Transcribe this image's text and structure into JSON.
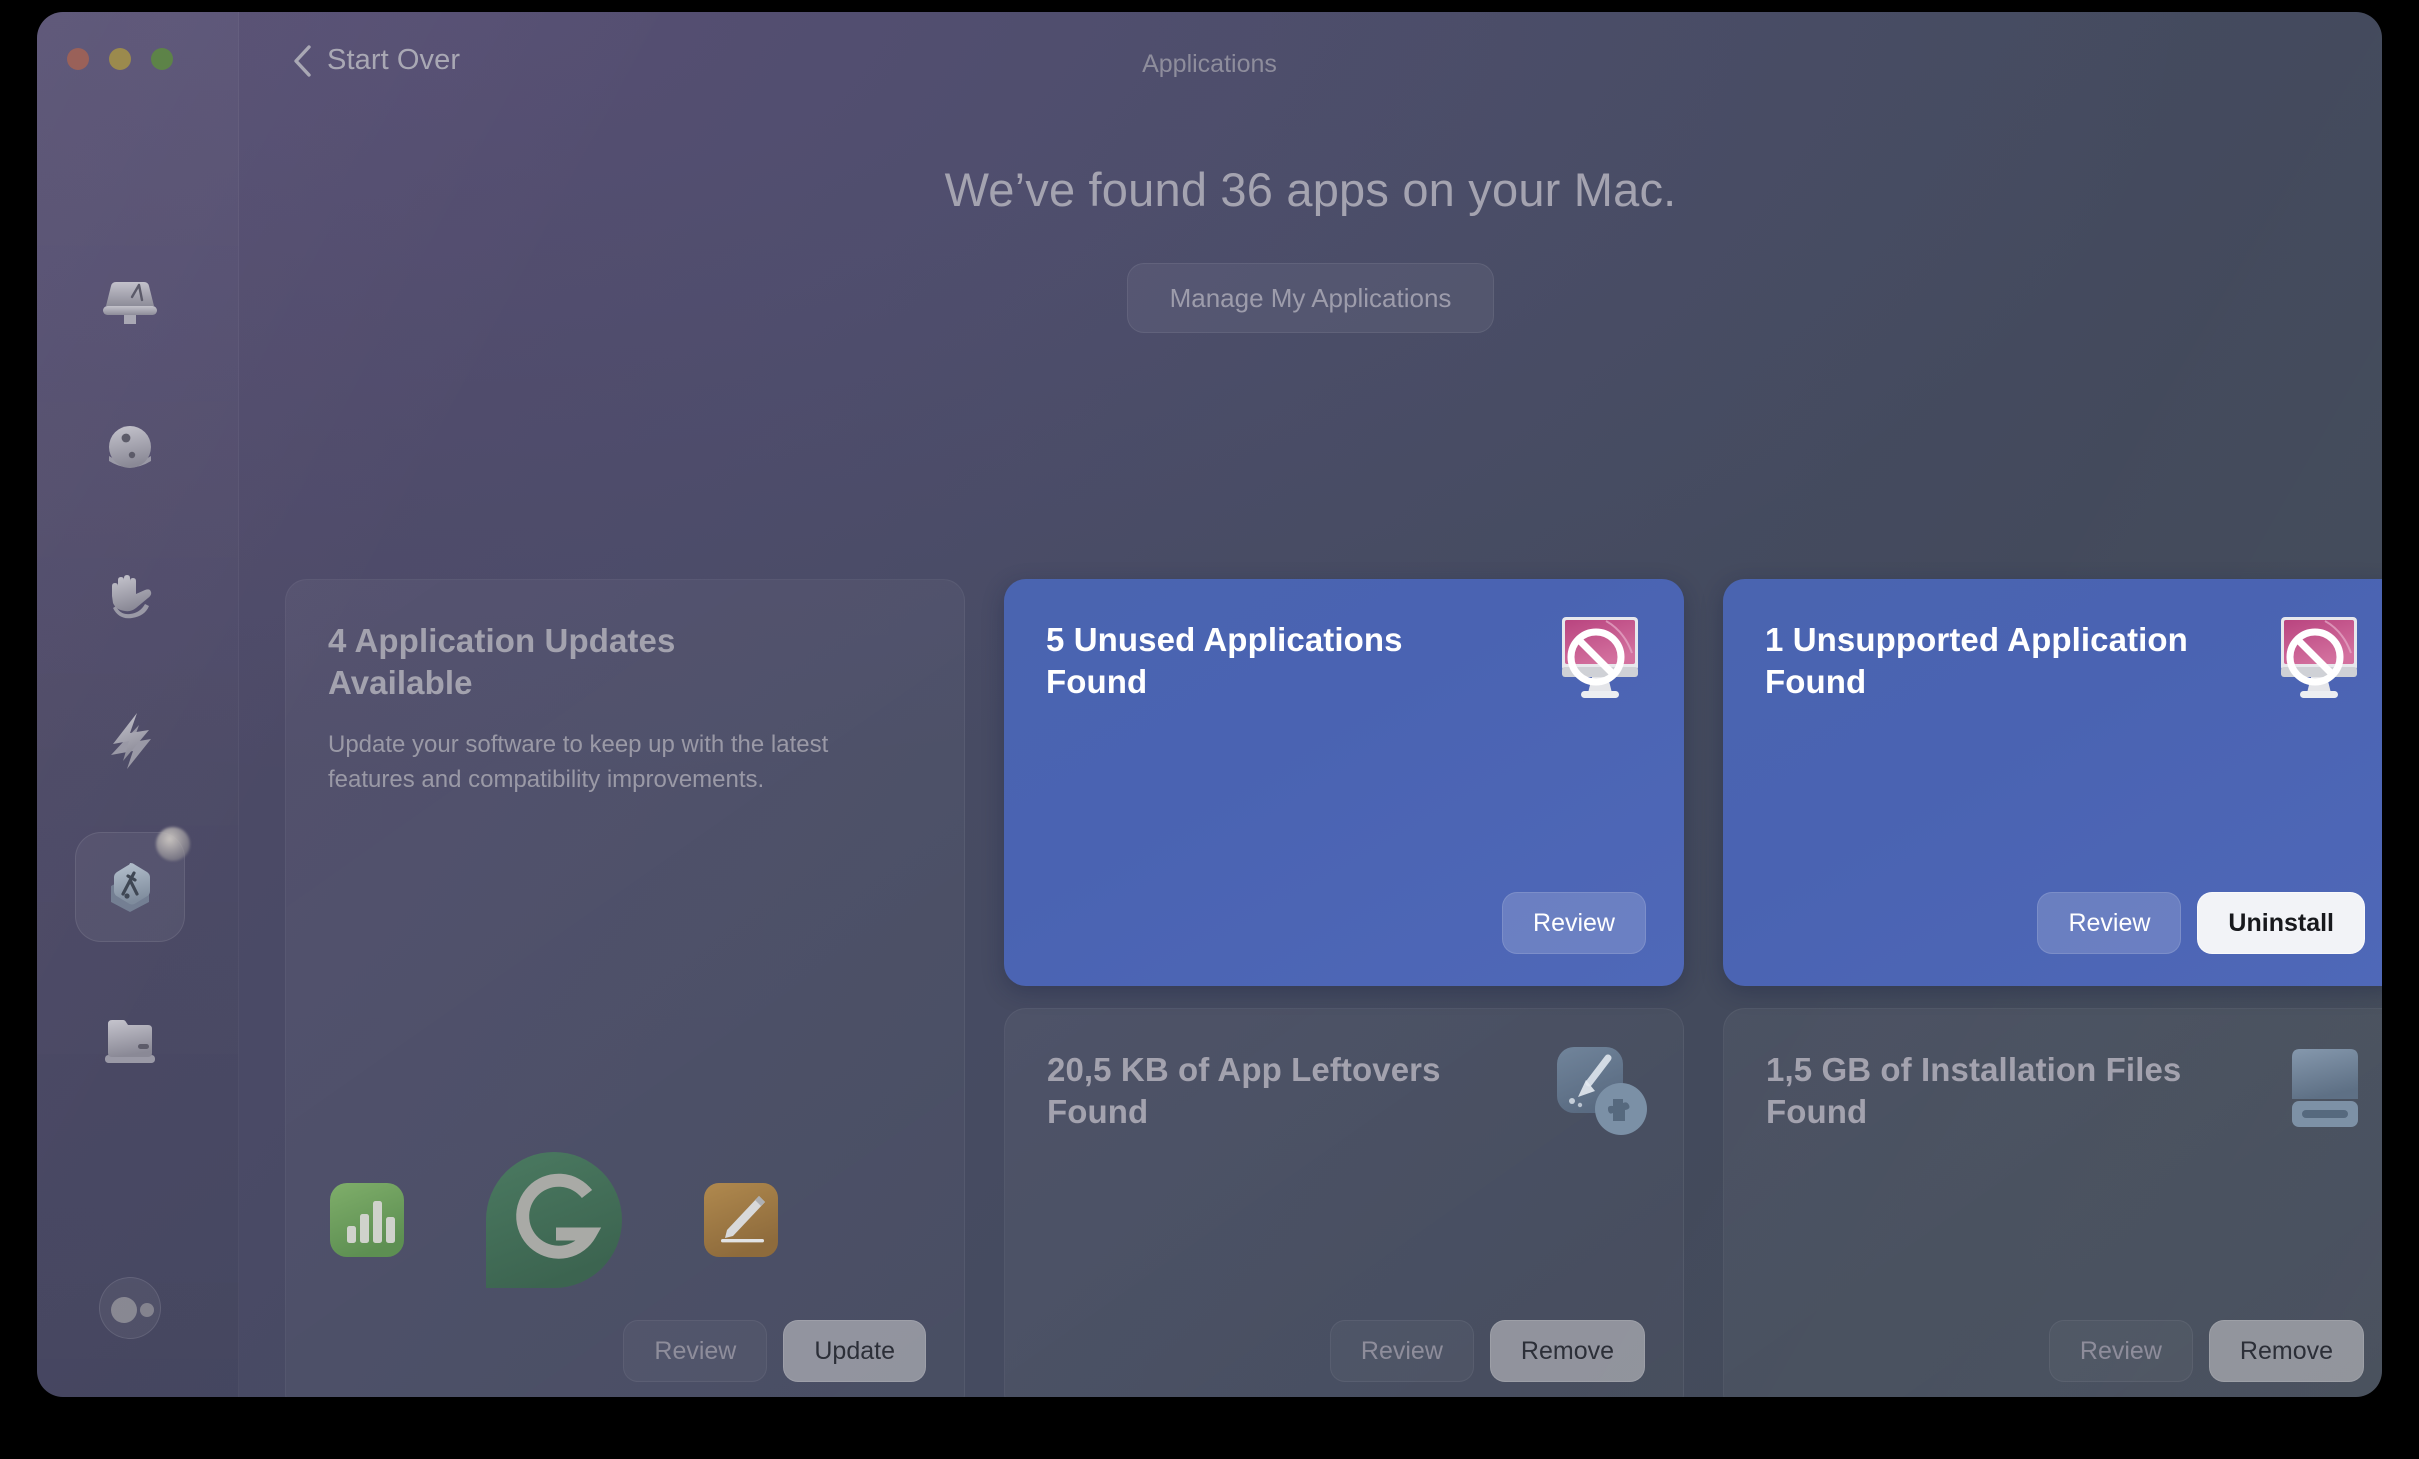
{
  "window": {
    "title": "Applications",
    "back_label": "Start Over",
    "traffic_lights": [
      "close-button",
      "minimize-button",
      "zoom-button"
    ]
  },
  "sidebar": {
    "items": [
      {
        "id": "smart-scan",
        "icon": "scanner-icon",
        "selected": false,
        "badge": false
      },
      {
        "id": "cleanup",
        "icon": "sphere-icon",
        "selected": false,
        "badge": false
      },
      {
        "id": "protection",
        "icon": "hand-icon",
        "selected": false,
        "badge": false
      },
      {
        "id": "performance",
        "icon": "lightning-bolt-icon",
        "selected": false,
        "badge": false
      },
      {
        "id": "applications",
        "icon": "app-hexagon-icon",
        "selected": true,
        "badge": true
      },
      {
        "id": "my-clutter",
        "icon": "folder-icon",
        "selected": false,
        "badge": false
      }
    ],
    "assistant": {
      "icon": "assistant-eyes-icon"
    }
  },
  "hero": {
    "heading": "We’ve found 36 apps on your Mac.",
    "manage_button": "Manage My Applications"
  },
  "cards": [
    {
      "id": "application-updates",
      "variant": "muted",
      "title": "4 Application Updates Available",
      "description": "Update your software to keep up with the latest features and compatibility improvements.",
      "app_icons": [
        "numbers-app-icon",
        "grammarly-app-icon",
        "pages-app-icon"
      ],
      "buttons": [
        {
          "label": "Review",
          "style": "ghost-muted"
        },
        {
          "label": "Update",
          "style": "solid-muted"
        }
      ]
    },
    {
      "id": "unused-applications",
      "variant": "accent",
      "title": "5 Unused Applications Found",
      "icon": "blocked-imac-icon",
      "buttons": [
        {
          "label": "Review",
          "style": "ghost-accent"
        }
      ]
    },
    {
      "id": "unsupported-application",
      "variant": "accent",
      "title": "1 Unsupported Application Found",
      "icon": "blocked-imac-icon",
      "buttons": [
        {
          "label": "Review",
          "style": "ghost-accent"
        },
        {
          "label": "Uninstall",
          "style": "solid-accent"
        }
      ]
    },
    {
      "id": "app-leftovers",
      "variant": "muted",
      "title": "20,5 KB of App Leftovers Found",
      "icon": "broom-puzzle-icon",
      "buttons": [
        {
          "label": "Review",
          "style": "ghost-muted"
        },
        {
          "label": "Remove",
          "style": "solid-muted"
        }
      ]
    },
    {
      "id": "installation-files",
      "variant": "muted",
      "title": "1,5 GB of Installation Files Found",
      "icon": "disk-drive-icon",
      "buttons": [
        {
          "label": "Review",
          "style": "ghost-muted"
        },
        {
          "label": "Remove",
          "style": "solid-muted"
        }
      ]
    }
  ],
  "colors": {
    "accent_card": "#4a64b0",
    "window_purple": "#4f4a68",
    "window_slate": "#414957",
    "muted_text": "#9a99a6",
    "heading_text": "#a4a3b0"
  }
}
